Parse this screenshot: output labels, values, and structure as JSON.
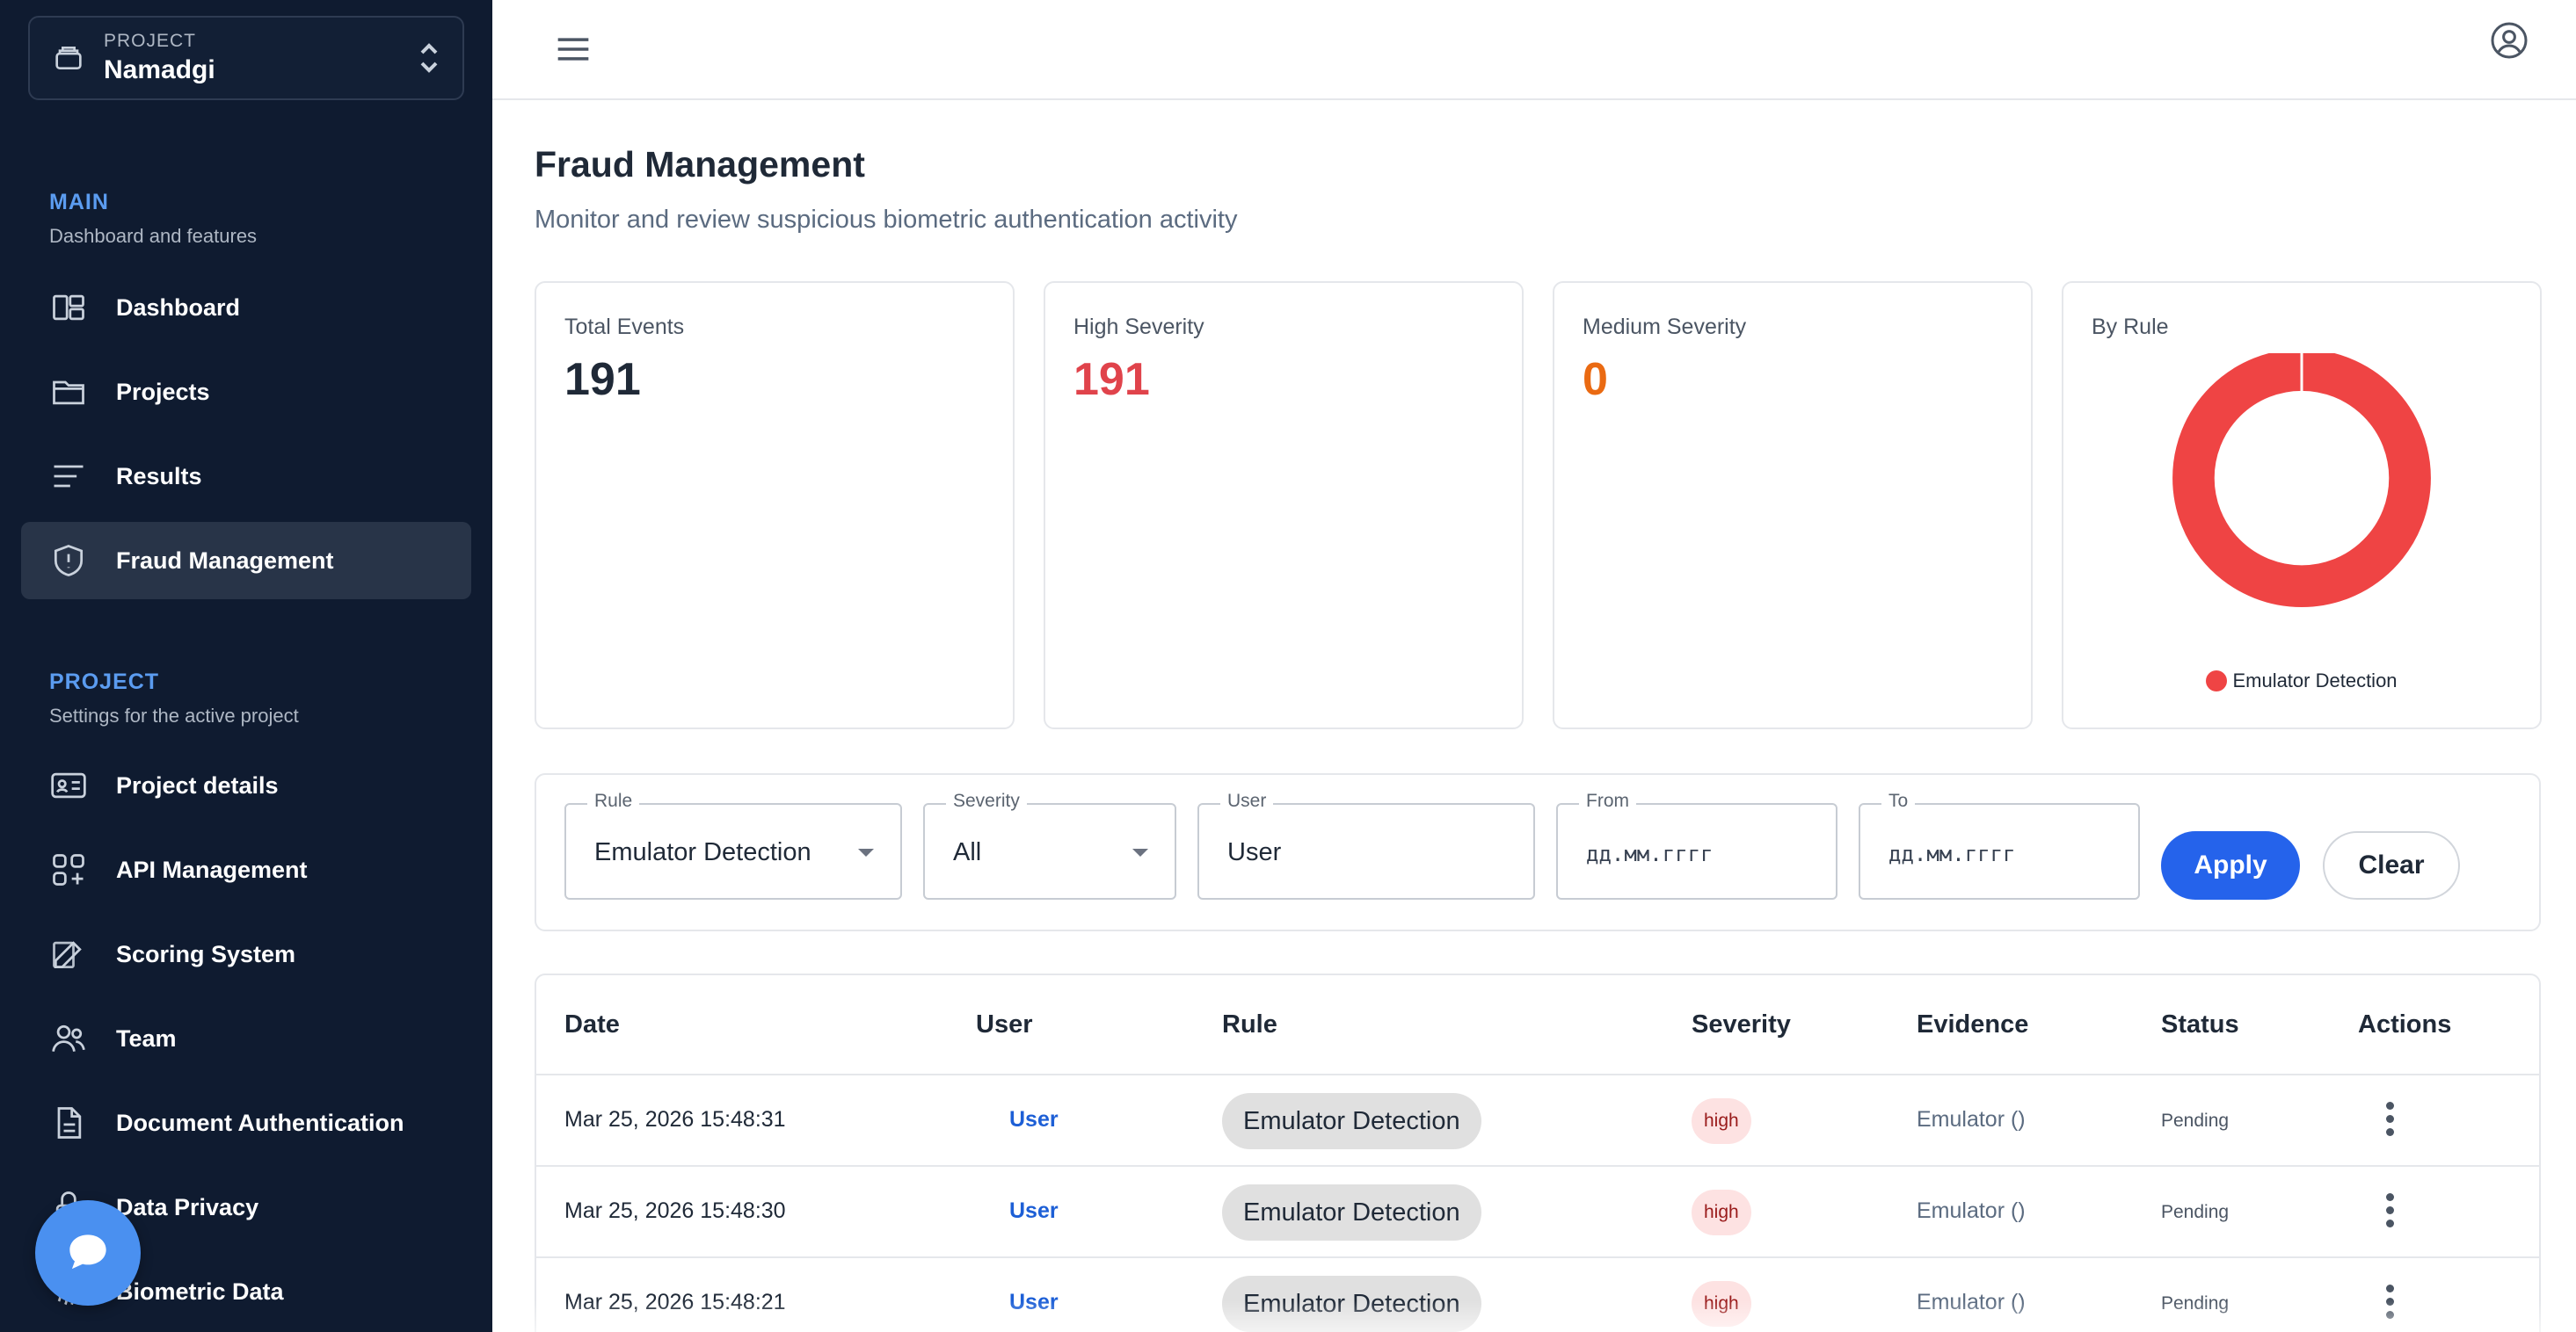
{
  "project_switcher": {
    "caption": "PROJECT",
    "name": "Namadgi"
  },
  "sidebar": {
    "main_section": {
      "title": "MAIN",
      "subtitle": "Dashboard and features"
    },
    "main_items": [
      {
        "label": "Dashboard",
        "icon": "dashboard-icon"
      },
      {
        "label": "Projects",
        "icon": "folder-icon"
      },
      {
        "label": "Results",
        "icon": "list-icon"
      },
      {
        "label": "Fraud Management",
        "icon": "shield-icon",
        "active": true
      }
    ],
    "project_section": {
      "title": "PROJECT",
      "subtitle": "Settings for the active project"
    },
    "project_items": [
      {
        "label": "Project details",
        "icon": "id-card-icon"
      },
      {
        "label": "API Management",
        "icon": "apps-add-icon"
      },
      {
        "label": "Scoring System",
        "icon": "edit-icon"
      },
      {
        "label": "Team",
        "icon": "users-icon"
      },
      {
        "label": "Document Authentication",
        "icon": "document-icon"
      },
      {
        "label": "Data Privacy",
        "icon": "lock-icon"
      },
      {
        "label": "Biometric Data",
        "icon": "fingerprint-icon"
      }
    ]
  },
  "page": {
    "title": "Fraud Management",
    "subtitle": "Monitor and review suspicious biometric authentication activity"
  },
  "stats": {
    "total": {
      "label": "Total Events",
      "value": "191",
      "color": "#1f2937"
    },
    "high": {
      "label": "High Severity",
      "value": "191",
      "color": "#e0434b"
    },
    "medium": {
      "label": "Medium Severity",
      "value": "0",
      "color": "#ea6a12"
    },
    "by_rule": {
      "label": "By Rule"
    }
  },
  "chart_data": {
    "type": "pie",
    "title": "By Rule",
    "categories": [
      "Emulator Detection"
    ],
    "values": [
      191
    ],
    "colors": [
      "#ef4444"
    ],
    "legend": "bottom"
  },
  "filters": {
    "rule": {
      "label": "Rule",
      "value": "Emulator Detection"
    },
    "severity": {
      "label": "Severity",
      "value": "All"
    },
    "user": {
      "label": "User",
      "placeholder": "User"
    },
    "from": {
      "label": "From",
      "placeholder": "дд.мм.гггг"
    },
    "to": {
      "label": "To",
      "placeholder": "дд.мм.гггг"
    },
    "apply_label": "Apply",
    "clear_label": "Clear"
  },
  "table": {
    "columns": [
      "Date",
      "User",
      "Rule",
      "Severity",
      "Evidence",
      "Status",
      "Actions"
    ],
    "rows": [
      {
        "date": "Mar 25, 2026 15:48:31",
        "user": "User",
        "rule": "Emulator Detection",
        "severity": "high",
        "evidence": "Emulator ()",
        "status": "Pending"
      },
      {
        "date": "Mar 25, 2026 15:48:30",
        "user": "User",
        "rule": "Emulator Detection",
        "severity": "high",
        "evidence": "Emulator ()",
        "status": "Pending"
      },
      {
        "date": "Mar 25, 2026 15:48:21",
        "user": "User",
        "rule": "Emulator Detection",
        "severity": "high",
        "evidence": "Emulator ()",
        "status": "Pending"
      }
    ]
  },
  "colors": {
    "accent": "#2563eb",
    "sidebar_bg": "#0f1b30",
    "section_title": "#5b9cf0"
  }
}
